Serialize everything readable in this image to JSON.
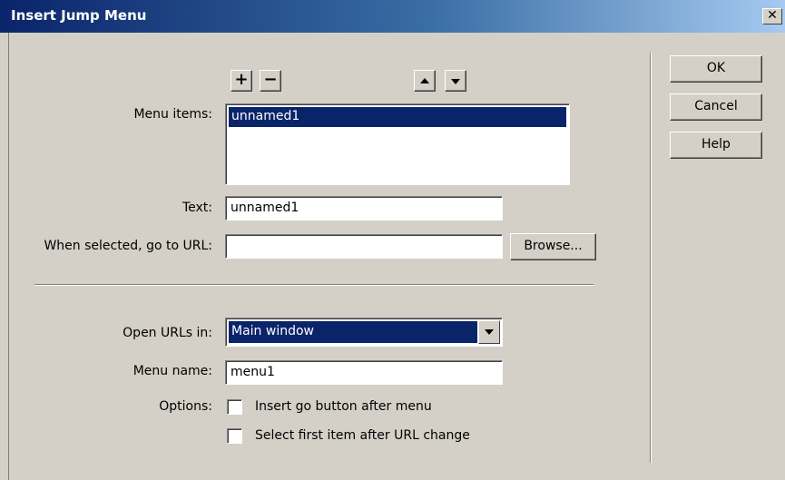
{
  "dialog": {
    "title": "Insert Jump Menu",
    "close_glyph": "✕"
  },
  "toolbar": {
    "add_glyph": "+",
    "remove_glyph": "−"
  },
  "labels": {
    "menu_items": "Menu items:",
    "text": "Text:",
    "url": "When selected, go to URL:",
    "open_in": "Open URLs in:",
    "menu_name": "Menu name:",
    "options": "Options:"
  },
  "menu_items": [
    "unnamed1"
  ],
  "fields": {
    "text_value": "unnamed1",
    "url_value": "",
    "open_in_value": "Main window",
    "menu_name_value": "menu1"
  },
  "options": {
    "insert_go_button": "Insert go button after menu",
    "insert_go_button_checked": false,
    "select_first_item": "Select first item after URL change",
    "select_first_item_checked": false
  },
  "buttons": {
    "browse": "Browse...",
    "ok": "OK",
    "cancel": "Cancel",
    "help": "Help"
  },
  "icons": {
    "add": "plus-icon",
    "remove": "minus-icon",
    "up": "arrow-up-icon",
    "down": "arrow-down-icon",
    "dropdown": "chevron-down-icon",
    "close": "close-icon"
  },
  "colors": {
    "title_start": "#0a246a",
    "title_end": "#a6caf0",
    "selection": "#0a246a",
    "face": "#d4d0c8"
  }
}
